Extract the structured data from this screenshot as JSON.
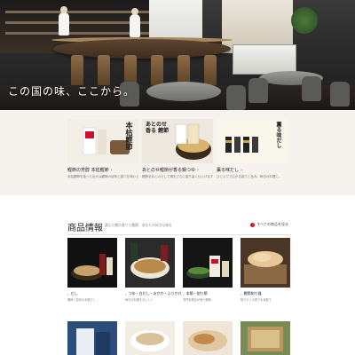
{
  "hero": {
    "caption": "この国の味、ここから。"
  },
  "features": [
    {
      "image_text": "本枯鰹節",
      "title": "鰹節の芳醇 本枯鰹節",
      "desc": "本枯鰹節を使った出汁は鰹節の旨味と香りを味わえます。"
    },
    {
      "image_text": "あとのせ 香る 鰹節",
      "title": "あとのせ鰹節が香る鍋つゆ",
      "desc": "鰹節をあとのせして鍋をさらに香り高く仕上げます。"
    },
    {
      "image_text": "薫る味だし",
      "title": "薫る味だし",
      "desc": "ひとふりで広がる香りと旨み。毎日の料理に。"
    }
  ],
  "products": {
    "title": "商品情報",
    "subtitle": "選んだ鰹の香りと鰹節、あなたの好きな味を",
    "view_all": "すべての商品を見る",
    "view_all_icon": "chevron-right-icon",
    "items": [
      {
        "name": "だし",
        "desc": "鰹節と昆布の本格だし"
      },
      {
        "name": "つゆ・白だし・おかか・ふりかけ",
        "desc": "毎日の料理をおいしく"
      },
      {
        "name": "本節・削り節",
        "desc": "専門料理店が使う鰹節"
      },
      {
        "name": "鰹節削り器",
        "desc": "削りたての香りを家庭で"
      }
    ]
  },
  "colors": {
    "accent": "#c8102e",
    "feature_bg": "#f6f3ef"
  }
}
